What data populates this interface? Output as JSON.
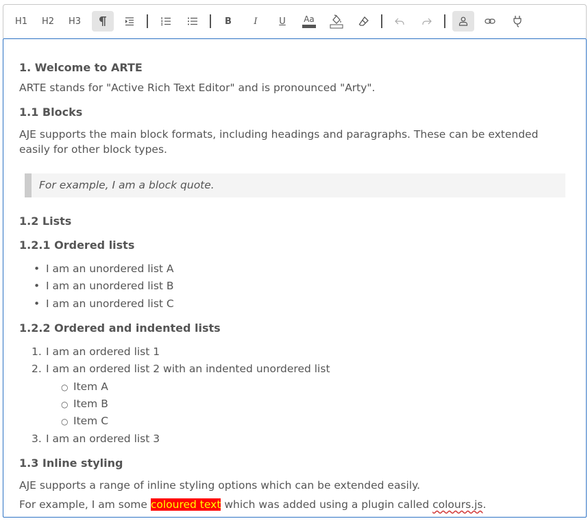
{
  "toolbar": {
    "h1": "H1",
    "h2": "H2",
    "h3": "H3",
    "bold": "B",
    "italic": "I",
    "underline": "U",
    "font_size": "Aa",
    "icons": [
      "paragraph-icon",
      "indent-icon",
      "ordered-list-icon",
      "unordered-list-icon",
      "font-color-icon",
      "fill-color-icon",
      "eraser-icon",
      "undo-icon",
      "redo-icon",
      "user-icon",
      "link-icon",
      "plugin-icon"
    ],
    "active_items": [
      "paragraph",
      "user"
    ]
  },
  "doc": {
    "h_welcome": "1. Welcome to ARTE",
    "p_arte": "ARTE stands for \"Active Rich Text Editor\" and is pronounced \"Arty\".",
    "h_blocks": "1.1 Blocks",
    "p_blocks_1": "AJE supports the main block formats, including headings and paragraphs. These can be extended",
    "p_blocks_2": "easily for other block types.",
    "quote": "For example, I am a block quote.",
    "h_lists": "1.2 Lists",
    "h_ordered": "1.2.1 Ordered lists",
    "unordered": [
      "I am an unordered list A",
      "I am an unordered list B",
      "I am an unordered list C"
    ],
    "h_ordered_indented": "1.2.2 Ordered and indented lists",
    "ordered": [
      "I am an ordered list 1",
      "I am an ordered list 2 with an indented unordered list",
      "I am an ordered list 3"
    ],
    "ordered_markers": [
      "1.",
      "2.",
      "3."
    ],
    "nested": [
      "Item A",
      "Item B",
      "Item C"
    ],
    "h_inline": "1.3 Inline styling",
    "p_inline": "AJE supports a range of inline styling options which can be extended easily.",
    "p_example_before": "For example, I am some ",
    "p_example_highlight": "coloured text",
    "p_example_middle": " which was added using a plugin called ",
    "p_example_link": "colours.js",
    "p_example_after": "."
  },
  "colors": {
    "editor_border": "#2d72c4",
    "highlight_bg": "#ff0000",
    "highlight_text": "#ffff00",
    "text": "#555555"
  }
}
